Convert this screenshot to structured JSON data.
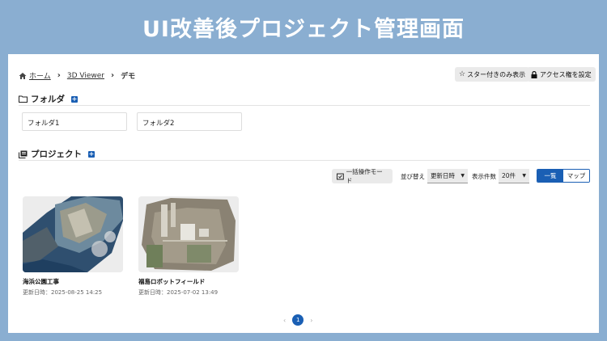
{
  "banner": {
    "title": "UI改善後プロジェクト管理画面"
  },
  "breadcrumb": {
    "home": "ホーム",
    "viewer": "3D Viewer",
    "current": "デモ"
  },
  "toolbar": {
    "starred_only": "スター付きのみ表示",
    "access": "アクセス権を設定"
  },
  "folders": {
    "heading": "フォルダ",
    "items": [
      "フォルダ1",
      "フォルダ2"
    ]
  },
  "projects": {
    "heading": "プロジェクト",
    "bulk_mode": "一括操作モード",
    "sort_label": "並び替え",
    "sort_value": "更新日時",
    "count_label": "表示件数",
    "count_value": "20件",
    "view_list": "一覧",
    "view_map": "マップ",
    "items": [
      {
        "title": "海浜公園工事",
        "date": "更新日時：2025-08-25 14:25"
      },
      {
        "title": "福島ロボットフィールド",
        "date": "更新日時：2025-07-02 13:49"
      }
    ]
  },
  "pagination": {
    "prev": "‹",
    "current": "1",
    "next": "›"
  },
  "colors": {
    "accent": "#1a5fb4",
    "background": "#8aaed1"
  }
}
